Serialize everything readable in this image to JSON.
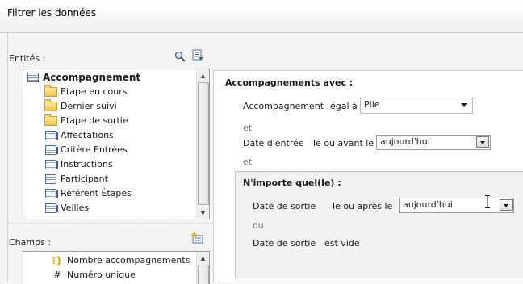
{
  "window": {
    "title": "Filtrer les données"
  },
  "entities": {
    "label": "Entités :",
    "items": [
      {
        "label": "Accompagnement",
        "icon": "table-icon",
        "bold": true
      },
      {
        "label": "Etape en cours",
        "icon": "folder-icon"
      },
      {
        "label": "Dernier suivi",
        "icon": "folder-icon"
      },
      {
        "label": "Etape de sortie",
        "icon": "folder-icon"
      },
      {
        "label": "Affectations",
        "icon": "linked-table-icon"
      },
      {
        "label": "Critère Entrées",
        "icon": "linked-table-icon"
      },
      {
        "label": "Instructions",
        "icon": "linked-table-icon"
      },
      {
        "label": "Participant",
        "icon": "table-icon"
      },
      {
        "label": "Référent Étapes",
        "icon": "linked-table-icon"
      },
      {
        "label": "Veilles",
        "icon": "linked-table-icon"
      }
    ]
  },
  "fields": {
    "label": "Champs :",
    "items": [
      {
        "label": "Nombre accompagnements",
        "icon": "sum-icon"
      },
      {
        "label": "Numéro unique",
        "icon": "hash-icon"
      }
    ]
  },
  "filter": {
    "header": "Accompagnements avec :",
    "cond1": {
      "field": "Accompagnement",
      "op": "égal à",
      "value": "Plie"
    },
    "and1": "et",
    "cond2": {
      "field": "Date d'entrée",
      "op": "le ou avant le",
      "value": "aujourd'hui"
    },
    "and2": "et",
    "group": {
      "header": "N'importe quel(le) :",
      "cond1": {
        "field": "Date de sortie",
        "op": "le ou après le",
        "value": "aujourd'hui"
      },
      "or": "ou",
      "cond2": {
        "field": "Date de sortie",
        "op": "est vide"
      }
    }
  }
}
